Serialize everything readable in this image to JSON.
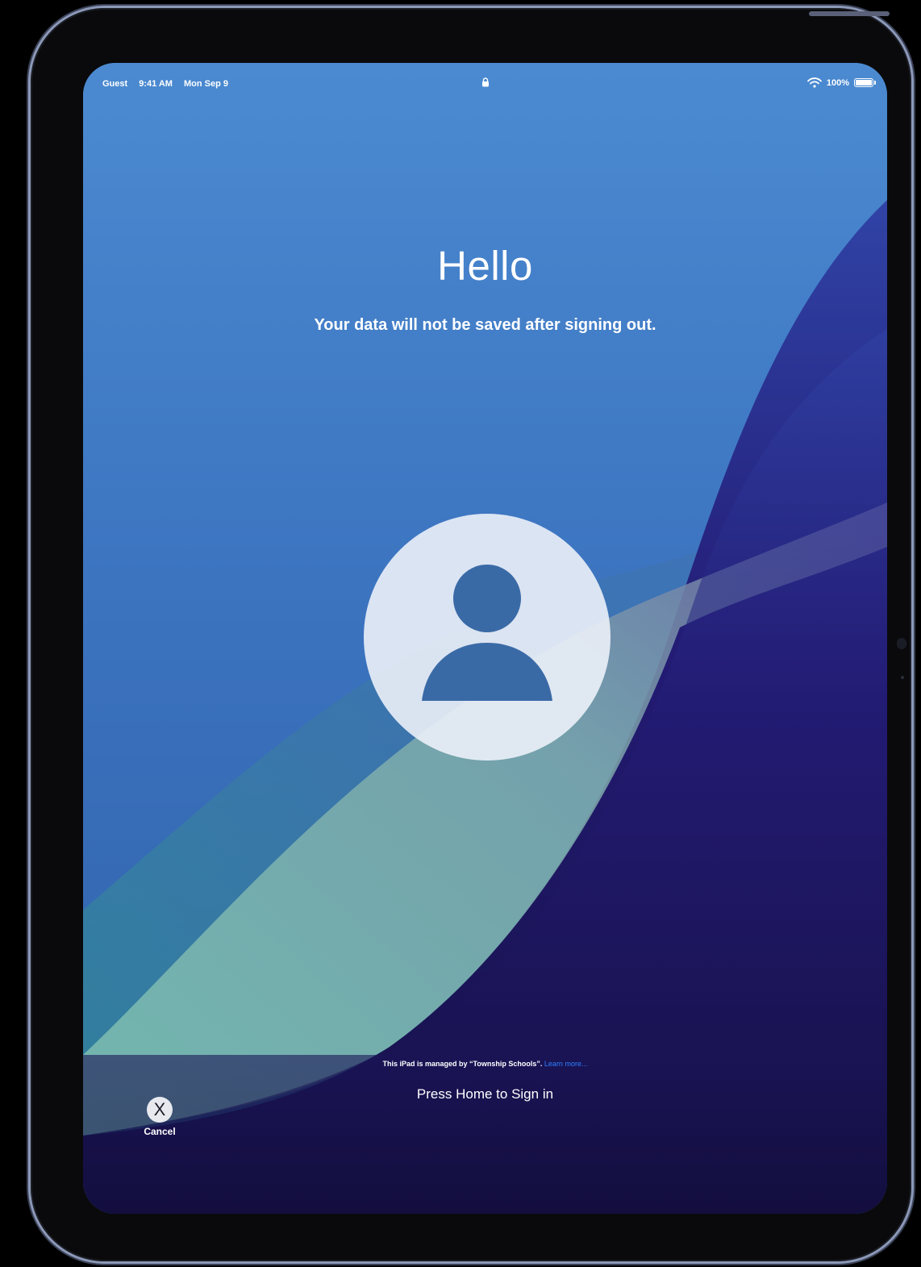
{
  "status_bar": {
    "user": "Guest",
    "time": "9:41 AM",
    "date": "Mon Sep 9",
    "battery": "100%",
    "battery_level": 1.0,
    "icons": [
      "lock-icon",
      "wifi-icon",
      "battery-icon"
    ]
  },
  "main": {
    "title": "Hello",
    "subtitle": "Your data will not be saved after signing out.",
    "avatar_icon": "person-icon"
  },
  "footer": {
    "managed_text": "This iPad is managed by “Township Schools”.",
    "learn_more": "Learn more...",
    "press_home": "Press Home to Sign in"
  },
  "cancel": {
    "symbol": "X",
    "label": "Cancel"
  },
  "colors": {
    "accent_link": "#2f7fff",
    "bezel": "#8c99b8"
  }
}
